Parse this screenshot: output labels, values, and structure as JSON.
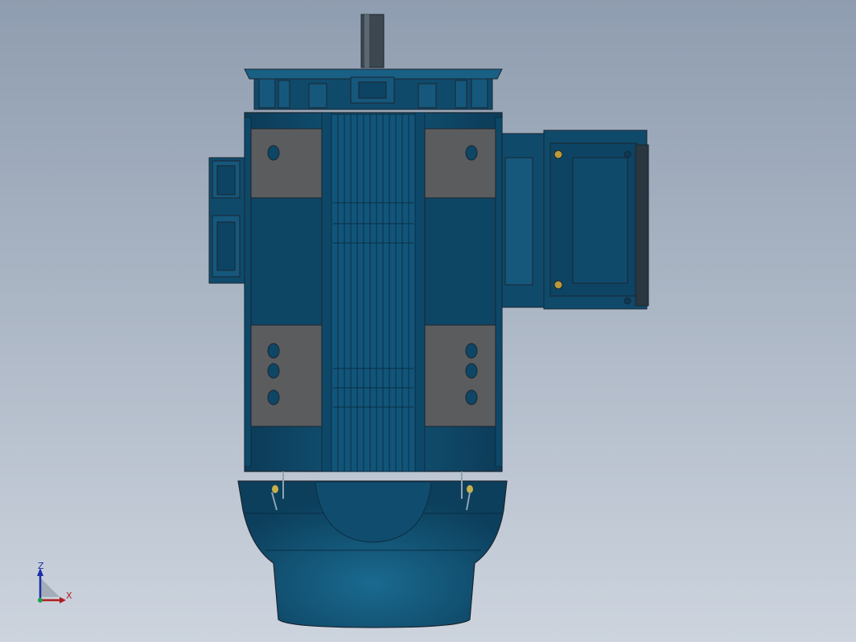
{
  "viewport": {
    "background_top": "#8f9db0",
    "background_bottom": "#cdd4de"
  },
  "model": {
    "description_name": "electric-motor-front-view",
    "body_color": "#0f4a6b",
    "body_dark": "#0b3a55",
    "body_edge": "#1b2530",
    "pad_color": "#5a5c5e",
    "shaft_color": "#3f4a52"
  },
  "triad": {
    "z_label": "Z",
    "x_label": "X",
    "z_color": "#1c2fa8",
    "x_color": "#b01c1c"
  }
}
